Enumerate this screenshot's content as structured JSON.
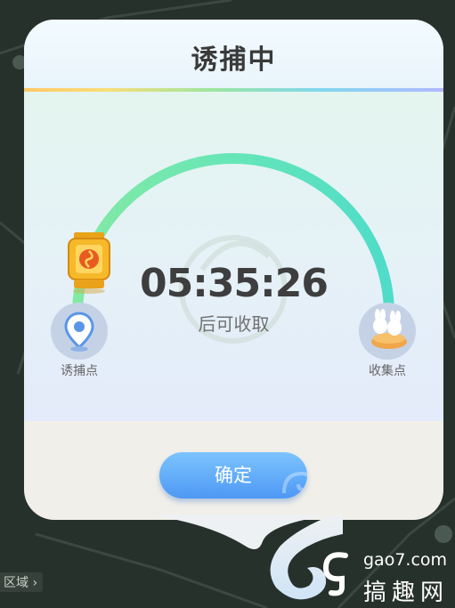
{
  "dialog": {
    "title": "诱捕中",
    "timer": "05:35:26",
    "subtitle": "后可收取",
    "start_point_label": "诱捕点",
    "end_point_label": "收集点",
    "confirm_label": "确定"
  },
  "map": {
    "region_label": "区域"
  },
  "watermark": {
    "url": "gao7.com",
    "name": "搞趣网"
  },
  "colors": {
    "arc_start": "#7ee8a7",
    "arc_end": "#4fdcc9",
    "button": "#5aa6f8",
    "title_text": "#3a3a3a"
  },
  "icons": [
    "location-pin-icon",
    "rabbit-cake-icon",
    "lantern-icon",
    "tail-swirl-icon",
    "chevron-right-icon"
  ]
}
